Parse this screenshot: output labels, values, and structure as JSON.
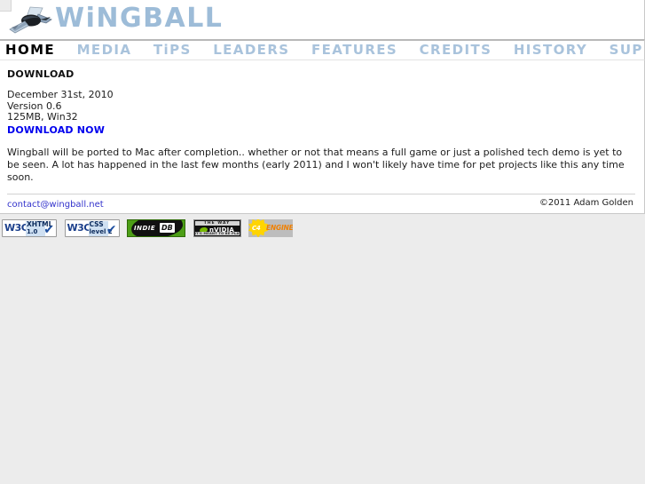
{
  "site": {
    "brand": "WiNGBALL",
    "logo_icon": "plane-logo-icon"
  },
  "nav": {
    "items": [
      {
        "label": "HOME",
        "active": true,
        "name": "nav-item-home"
      },
      {
        "label": "MEDIA",
        "active": false,
        "name": "nav-item-media"
      },
      {
        "label": "TiPS",
        "active": false,
        "name": "nav-item-tips"
      },
      {
        "label": "LEADERS",
        "active": false,
        "name": "nav-item-leaders"
      },
      {
        "label": "FEATURES",
        "active": false,
        "name": "nav-item-features"
      },
      {
        "label": "CREDITS",
        "active": false,
        "name": "nav-item-credits"
      },
      {
        "label": "HISTORY",
        "active": false,
        "name": "nav-item-history"
      },
      {
        "label": "SUPPORT",
        "active": false,
        "name": "nav-item-support"
      }
    ]
  },
  "main": {
    "title": "DOWNLOAD",
    "release_date": "December 31st, 2010",
    "version": "Version 0.6",
    "size_platform": "125MB, Win32",
    "download_link": "DOWNLOAD NOW",
    "paragraph": "Wingball will be ported to Mac after completion.. whether or not that means a full game or just a polished tech demo is yet to be seen. A lot has happened in the last few months (early 2011) and I won't likely have time for pet projects like this any time soon."
  },
  "footer": {
    "contact_email": "contact@wingball.net",
    "copyright": "©2011 Adam Golden"
  },
  "badges": {
    "xhtml": {
      "logo": "W3C",
      "line1": "XHTML",
      "line2": "1.0",
      "check": "✔"
    },
    "css": {
      "logo": "W3C",
      "line1": "CSS",
      "line2": "level 2",
      "check": "✔"
    },
    "indiedb": {
      "word": "INDIE",
      "db": "DB"
    },
    "nvidia": {
      "top": "THE WAY",
      "brand": "nVIDIA",
      "bottom": "IT'S MEANT TO BE PLAYED"
    },
    "c4": {
      "mark": "C4",
      "engine": "ENGINE"
    }
  },
  "colors": {
    "brand_blue": "#9dbcd8",
    "nav_inactive": "#a9c3dc",
    "nav_active": "#000000",
    "link_blue": "#0000ee",
    "page_bg": "#ececec",
    "panel_bg": "#ffffff"
  }
}
